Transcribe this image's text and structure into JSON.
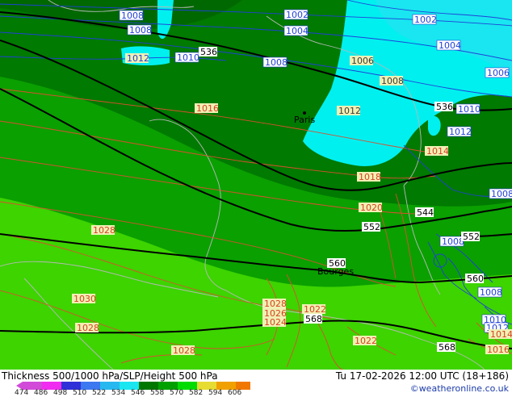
{
  "title": "Thickness 500/1000 hPa/SLP/Height 500 hPa",
  "valid_time": "Tu 17-02-2026 12:00 UTC (18+186)",
  "credit": "©weatheronline.co.uk",
  "scale": {
    "labels": [
      "474",
      "486",
      "498",
      "510",
      "522",
      "534",
      "546",
      "558",
      "570",
      "582",
      "594",
      "606"
    ],
    "colors": [
      "#d14bd8",
      "#f02cf0",
      "#3030d8",
      "#3c78f0",
      "#28b8f0",
      "#19e6f0",
      "#007800",
      "#00a000",
      "#00dc00",
      "#e6dc32",
      "#f0a000",
      "#f07800"
    ]
  },
  "cities": [
    {
      "name": "Paris"
    },
    {
      "name": "Bourges"
    }
  ],
  "isobar_labels_blue": [
    {
      "text": "1008"
    },
    {
      "text": "1002"
    },
    {
      "text": "1008"
    },
    {
      "text": "1004"
    },
    {
      "text": "1010"
    },
    {
      "text": "1008"
    },
    {
      "text": "1002"
    },
    {
      "text": "1004"
    },
    {
      "text": "1006"
    },
    {
      "text": "1010"
    },
    {
      "text": "1012"
    },
    {
      "text": "1008"
    },
    {
      "text": "1008"
    },
    {
      "text": "1008"
    },
    {
      "text": "1010"
    },
    {
      "text": "1012"
    }
  ],
  "isobar_labels_yellow": [
    {
      "text": "1012"
    },
    {
      "text": "1006"
    },
    {
      "text": "1008"
    },
    {
      "text": "1004"
    },
    {
      "text": "1012"
    }
  ],
  "isobar_labels_red": [
    {
      "text": "1016"
    },
    {
      "text": "1014"
    },
    {
      "text": "1018"
    },
    {
      "text": "1020"
    },
    {
      "text": "1028"
    },
    {
      "text": "1030"
    },
    {
      "text": "1028"
    },
    {
      "text": "1028"
    },
    {
      "text": "1026"
    },
    {
      "text": "1024"
    },
    {
      "text": "1022"
    },
    {
      "text": "1022"
    },
    {
      "text": "1028"
    },
    {
      "text": "1014"
    },
    {
      "text": "1016"
    }
  ],
  "height_labels": [
    {
      "text": "536"
    },
    {
      "text": "536"
    },
    {
      "text": "544"
    },
    {
      "text": "552"
    },
    {
      "text": "552"
    },
    {
      "text": "560"
    },
    {
      "text": "560"
    },
    {
      "text": "568"
    },
    {
      "text": "568"
    }
  ]
}
